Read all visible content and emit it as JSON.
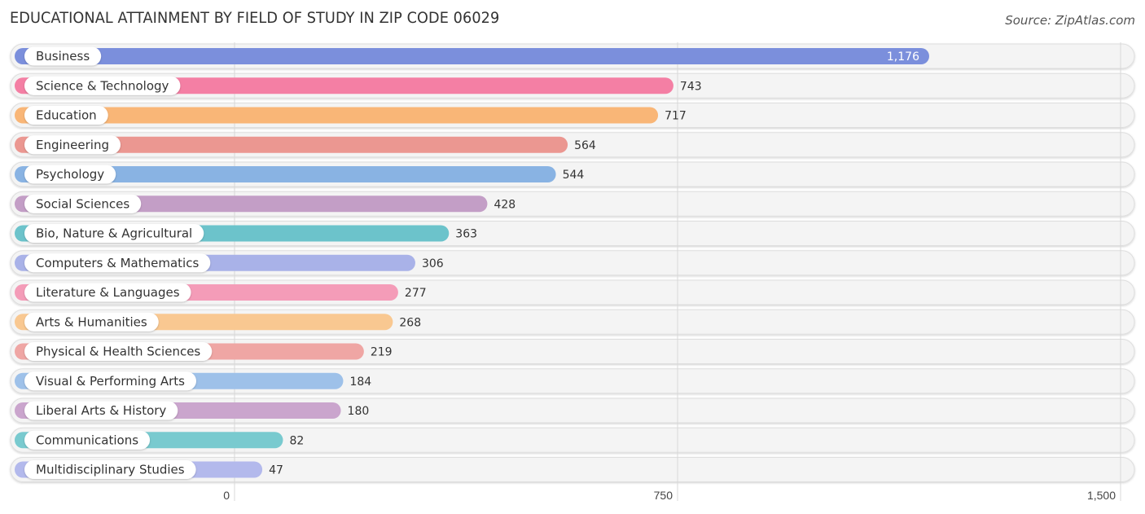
{
  "header": {
    "title": "EDUCATIONAL ATTAINMENT BY FIELD OF STUDY IN ZIP CODE 06029",
    "source": "Source: ZipAtlas.com"
  },
  "chart_data": {
    "type": "bar",
    "orientation": "horizontal",
    "title": "EDUCATIONAL ATTAINMENT BY FIELD OF STUDY IN ZIP CODE 06029",
    "xlabel": "",
    "ylabel": "",
    "xlim": [
      0,
      1500
    ],
    "grid": true,
    "legend": "none",
    "ticks": [
      {
        "value": 0,
        "label": "0"
      },
      {
        "value": 750,
        "label": "750"
      },
      {
        "value": 1500,
        "label": "1,500"
      }
    ],
    "categories": [
      "Business",
      "Science & Technology",
      "Education",
      "Engineering",
      "Psychology",
      "Social Sciences",
      "Bio, Nature & Agricultural",
      "Computers & Mathematics",
      "Literature & Languages",
      "Arts & Humanities",
      "Physical & Health Sciences",
      "Visual & Performing Arts",
      "Liberal Arts & History",
      "Communications",
      "Multidisciplinary Studies"
    ],
    "values": [
      1176,
      743,
      717,
      564,
      544,
      428,
      363,
      306,
      277,
      268,
      219,
      184,
      180,
      82,
      47
    ],
    "value_labels": [
      "1,176",
      "743",
      "717",
      "564",
      "544",
      "428",
      "363",
      "306",
      "277",
      "268",
      "219",
      "184",
      "180",
      "82",
      "47"
    ],
    "colors": [
      "#7b8fdc",
      "#f47fa4",
      "#f9b677",
      "#eb9791",
      "#89b3e3",
      "#c39ec6",
      "#6cc3cb",
      "#a9b2e8",
      "#f49cb8",
      "#f9c891",
      "#efa6a4",
      "#9ec1e9",
      "#caa5cd",
      "#79cacf",
      "#b3b9ec"
    ]
  }
}
